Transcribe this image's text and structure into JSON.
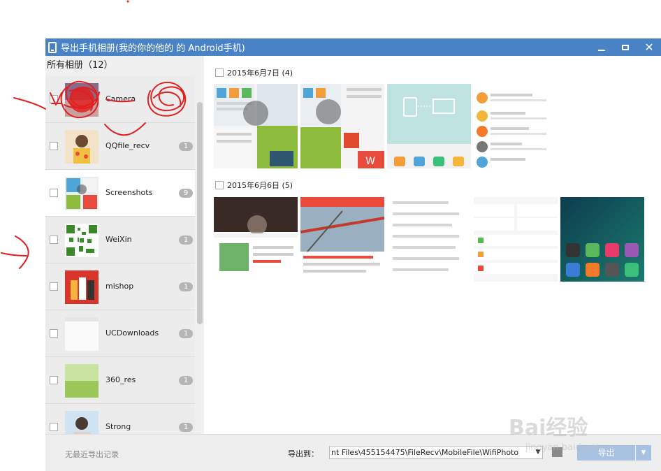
{
  "window": {
    "title": "导出手机相册(我的你的他的 的 Android手机)",
    "controls": {
      "minimize": "—",
      "maximize": "□",
      "close": "✕"
    }
  },
  "sidebar": {
    "header": "所有相册（12）",
    "albums": [
      {
        "name": "Camera",
        "count": "",
        "thumb": "camera-scribbled",
        "selected": false
      },
      {
        "name": "QQfile_recv",
        "count": "1",
        "thumb": "girl-photo",
        "selected": false
      },
      {
        "name": "Screenshots",
        "count": "9",
        "thumb": "screenshot-grid",
        "selected": true
      },
      {
        "name": "WeiXin",
        "count": "1",
        "thumb": "qr-code",
        "selected": false
      },
      {
        "name": "mishop",
        "count": "1",
        "thumb": "phones-red",
        "selected": false
      },
      {
        "name": "UCDownloads",
        "count": "1",
        "thumb": "blank-page",
        "selected": false
      },
      {
        "name": "360_res",
        "count": "1",
        "thumb": "green-field",
        "selected": false
      },
      {
        "name": "Strong",
        "count": "1",
        "thumb": "person-photo",
        "selected": false
      }
    ]
  },
  "main": {
    "groups": [
      {
        "date": "2015年6月7日 (4)"
      },
      {
        "date": "2015年6月6日 (5)"
      }
    ]
  },
  "footer": {
    "history": "无最近导出记录",
    "export_to_label": "导出到：",
    "path": "nt Files\\455154475\\FileRecv\\MobileFile\\WifiPhoto",
    "export_button": "导出"
  },
  "watermark": {
    "text": "Bai经验",
    "url": "jingyan.baidu.com"
  },
  "colors": {
    "titlebar": "#4a83c5",
    "sidebar": "#f0f0f0",
    "accent_red": "#e02020",
    "export_button": "#a8c3e2"
  }
}
